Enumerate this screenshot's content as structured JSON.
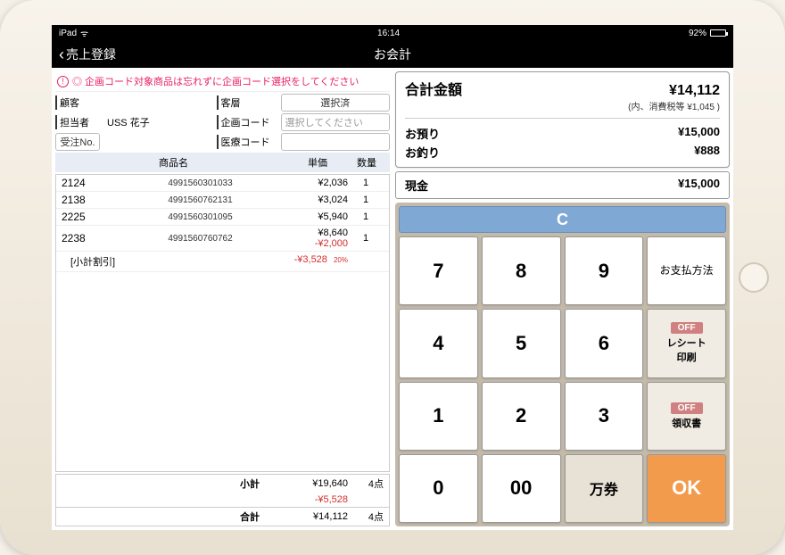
{
  "status": {
    "carrier": "iPad",
    "time": "16:14",
    "battery_pct": "92%"
  },
  "nav": {
    "back": "売上登録",
    "title": "お会計"
  },
  "notice": "◎ 企画コード対象商品は忘れずに企画コード選択をしてください",
  "form": {
    "customer_label": "顧客",
    "segment_label": "客層",
    "segment_value": "選択済",
    "staff_label": "担当者",
    "staff_value": "USS 花子",
    "campaign_label": "企画コード",
    "campaign_placeholder": "選択してください",
    "order_label": "受注No.",
    "medical_label": "医療コード"
  },
  "table": {
    "col_name": "商品名",
    "col_price": "単価",
    "col_qty": "数量",
    "rows": [
      {
        "code": "2124",
        "barcode": "4991560301033",
        "price": "¥2,036",
        "qty": "1"
      },
      {
        "code": "2138",
        "barcode": "4991560762131",
        "price": "¥3,024",
        "qty": "1"
      },
      {
        "code": "2225",
        "barcode": "4991560301095",
        "price": "¥5,940",
        "qty": "1"
      },
      {
        "code": "2238",
        "barcode": "4991560760762",
        "price": "¥8,640",
        "discount": "-¥2,000",
        "qty": "1"
      }
    ],
    "subtotal_discount_label": "[小計割引]",
    "subtotal_discount_amount": "-¥3,528",
    "subtotal_discount_pct": "20%"
  },
  "totals": {
    "subtotal_label": "小計",
    "subtotal": "¥19,640",
    "subtotal_qty": "4点",
    "subtotal_discount": "-¥5,528",
    "total_label": "合計",
    "total": "¥14,112",
    "total_qty": "4点"
  },
  "payment": {
    "total_label": "合計金額",
    "total": "¥14,112",
    "tax_label": "(内、消費税等",
    "tax": "¥1,045 )",
    "deposit_label": "お預り",
    "deposit": "¥15,000",
    "change_label": "お釣り",
    "change": "¥888",
    "cash_label": "現金",
    "cash": "¥15,000"
  },
  "keypad": {
    "clear": "C",
    "k7": "7",
    "k8": "8",
    "k9": "9",
    "pay_method": "お支払方法",
    "k4": "4",
    "k5": "5",
    "k6": "6",
    "off": "OFF",
    "receipt": "レシート\n印刷",
    "k1": "1",
    "k2": "2",
    "k3": "3",
    "invoice": "領収書",
    "k0": "0",
    "k00": "00",
    "man": "万券",
    "ok": "OK"
  }
}
